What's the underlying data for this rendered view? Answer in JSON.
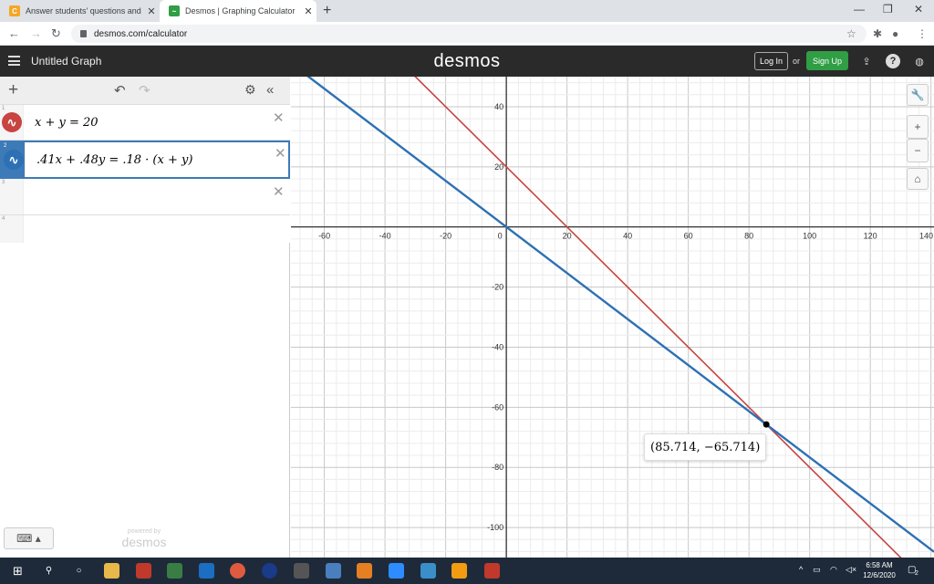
{
  "browser": {
    "tabs": [
      {
        "title": "Answer students' questions and",
        "active": false,
        "favicon": "chegg-favicon"
      },
      {
        "title": "Desmos | Graphing Calculator",
        "active": true,
        "favicon": "desmos-favicon"
      }
    ],
    "url": "desmos.com/calculator"
  },
  "header": {
    "graph_title": "Untitled Graph",
    "brand": "desmos",
    "login_label": "Log In",
    "or_label": "or",
    "signup_label": "Sign Up",
    "signup_color": "#2f9e44"
  },
  "expressions": [
    {
      "index": "1",
      "latex": "x + y  =  20",
      "color": "#c74440"
    },
    {
      "index": "2",
      "latex": ".41x + .48y  =  .18  ·  (x + y)",
      "color": "#2d70b3"
    },
    {
      "index": "3",
      "latex": ""
    },
    {
      "index": "4",
      "latex": ""
    }
  ],
  "footer": {
    "powered_by": "powered by",
    "brand": "desmos"
  },
  "point_label": "(85.714, −65.714)",
  "chart_data": {
    "type": "line",
    "xlim": [
      -71,
      141
    ],
    "ylim": [
      -110,
      50
    ],
    "x_ticks": [
      -60,
      -40,
      -20,
      0,
      20,
      40,
      60,
      80,
      100,
      120,
      140
    ],
    "y_ticks": [
      40,
      20,
      -20,
      -40,
      -60,
      -80,
      -100
    ],
    "grid": true,
    "series": [
      {
        "expression": "x + y = 20",
        "slope": -1,
        "intercept": 20,
        "color": "#c74440"
      },
      {
        "expression": ".41x + .48y = .18 · (x + y)",
        "slope": -0.7666667,
        "intercept": 0,
        "color": "#2d70b3"
      }
    ],
    "points": [
      {
        "x": 85.714,
        "y": -65.714
      }
    ]
  },
  "taskbar": {
    "time": "6:58 AM",
    "date": "12/6/2020",
    "notifications": "2"
  }
}
